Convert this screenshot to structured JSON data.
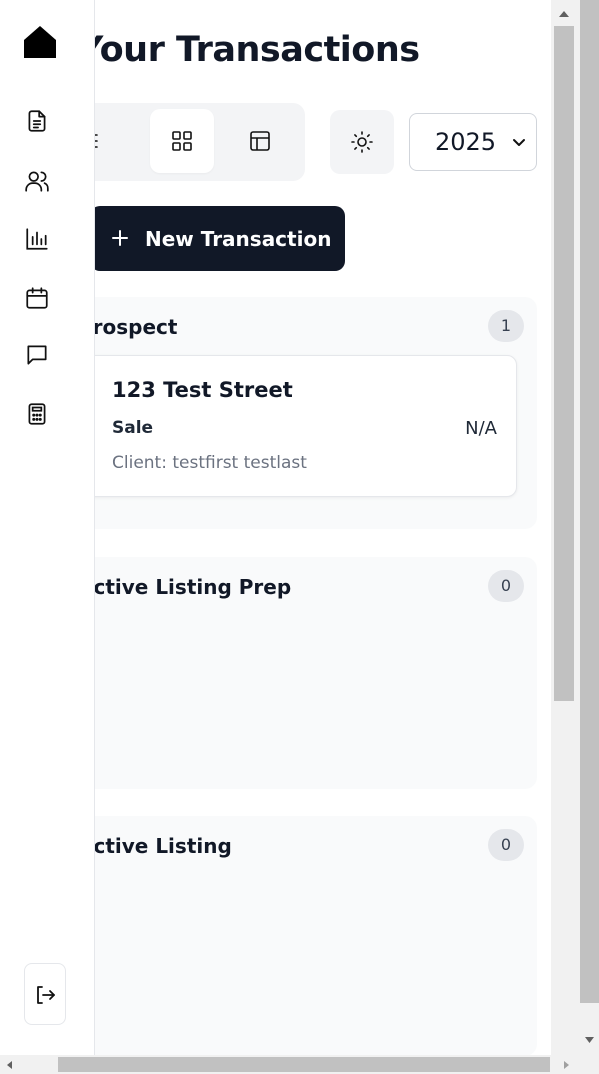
{
  "page": {
    "title": "Your Transactions"
  },
  "sidebar": {
    "logo_icon": "house-icon",
    "items": [
      {
        "name": "documents",
        "icon": "document-icon"
      },
      {
        "name": "clients",
        "icon": "users-icon"
      },
      {
        "name": "reports",
        "icon": "bar-chart-icon"
      },
      {
        "name": "calendar",
        "icon": "calendar-icon"
      },
      {
        "name": "messages",
        "icon": "message-icon"
      },
      {
        "name": "calculator",
        "icon": "calculator-icon"
      }
    ],
    "logout_icon": "logout-icon"
  },
  "toolbar": {
    "views": [
      {
        "name": "list",
        "icon": "list-icon",
        "active": false
      },
      {
        "name": "grid",
        "icon": "grid-icon",
        "active": true
      },
      {
        "name": "table",
        "icon": "table-icon",
        "active": false
      }
    ],
    "theme_icon": "sun-icon",
    "year_selected": "2025",
    "new_transaction_label": "New Transaction"
  },
  "columns": [
    {
      "title": "Prospect",
      "count": "1",
      "cards": [
        {
          "address": "123 Test Street",
          "type": "Sale",
          "price": "N/A",
          "client": "Client: testfirst testlast"
        }
      ]
    },
    {
      "title": "Active Listing Prep",
      "count": "0",
      "cards": []
    },
    {
      "title": "Active Listing",
      "count": "0",
      "cards": []
    }
  ],
  "colors": {
    "primary_dark": "#111827",
    "column_bg": "#f9fafb",
    "badge_bg": "#e5e7eb",
    "muted_text": "#6b7280"
  }
}
